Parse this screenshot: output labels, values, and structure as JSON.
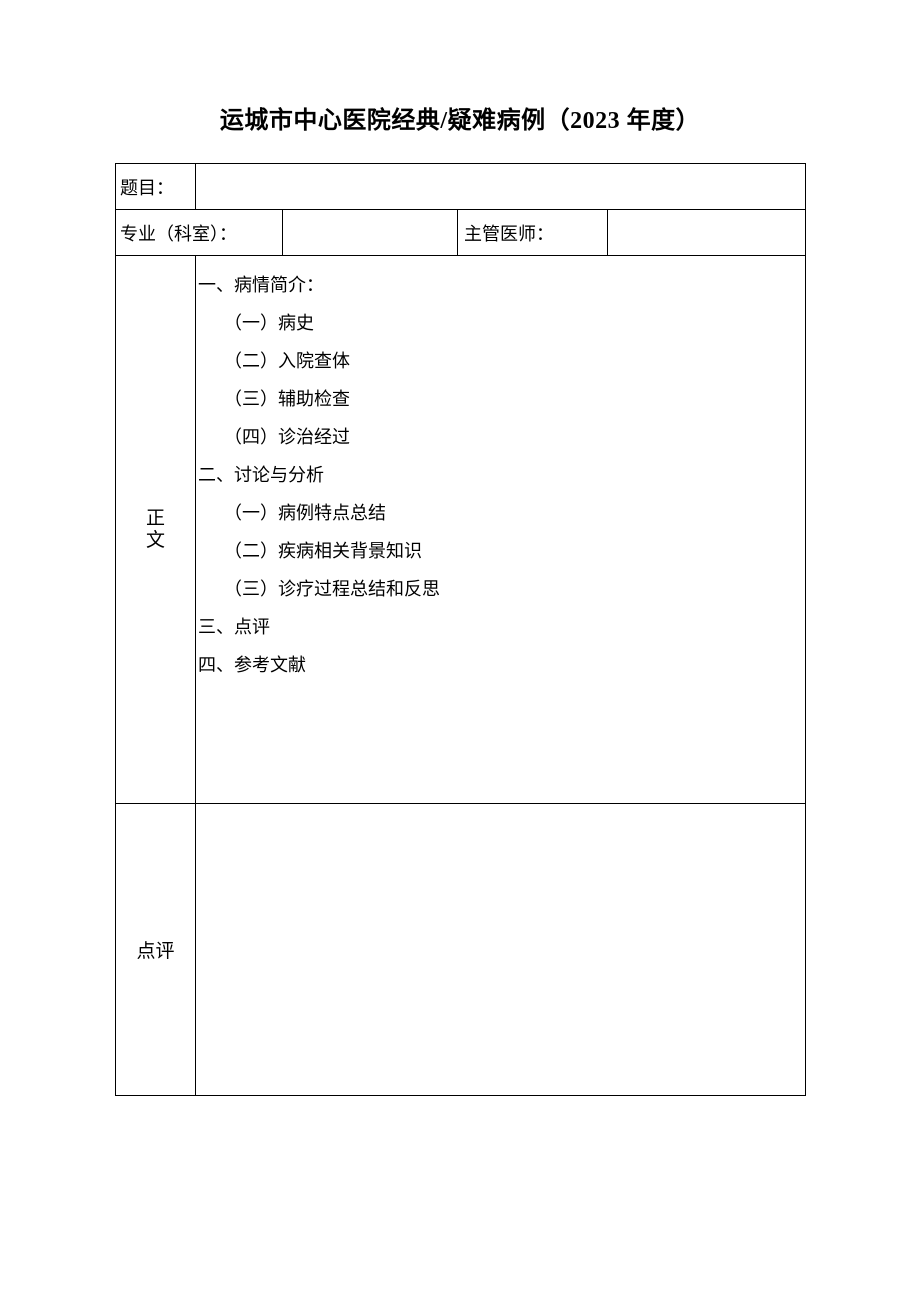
{
  "title": "运城市中心医院经典/疑难病例（2023 年度）",
  "labels": {
    "topic": "题目：",
    "department": "专业（科室）：",
    "physician": "主管医师：",
    "body": "正文",
    "review": "点评"
  },
  "values": {
    "topic": "",
    "department": "",
    "physician": "",
    "review_content": ""
  },
  "body_outline": {
    "l1": "一、病情简介：",
    "l2": "（一）病史",
    "l3": "（二）入院查体",
    "l4": "（三）辅助检查",
    "l5": "（四）诊治经过",
    "l6": "二、讨论与分析",
    "l7": "（一）病例特点总结",
    "l8": "（二）疾病相关背景知识",
    "l9": "（三）诊疗过程总结和反思",
    "l10": "三、点评",
    "l11": "四、参考文献"
  }
}
